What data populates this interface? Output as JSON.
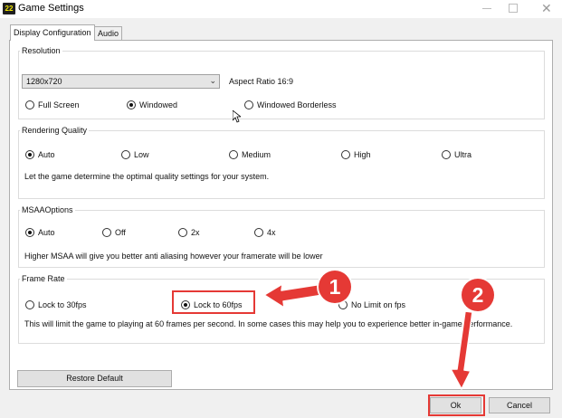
{
  "window": {
    "title": "Game Settings",
    "icon_text": "22"
  },
  "tabs": [
    {
      "label": "Display Configuration",
      "active": true
    },
    {
      "label": "Audio",
      "active": false
    }
  ],
  "resolution": {
    "label": "Resolution",
    "dropdown_value": "1280x720",
    "aspect_ratio": "Aspect Ratio 16:9",
    "modes": [
      "Full Screen",
      "Windowed",
      "Windowed Borderless"
    ],
    "selected": "Windowed"
  },
  "rendering": {
    "label": "Rendering Quality",
    "options": [
      "Auto",
      "Low",
      "Medium",
      "High",
      "Ultra"
    ],
    "selected": "Auto",
    "description": "Let the game determine the optimal quality settings for your system."
  },
  "msaa": {
    "label": "MSAAOptions",
    "options": [
      "Auto",
      "Off",
      "2x",
      "4x"
    ],
    "selected": "Auto",
    "description": "Higher MSAA will give you better anti aliasing however your framerate will be lower"
  },
  "framerate": {
    "label": "Frame Rate",
    "options": [
      "Lock  to 30fps",
      "Lock to 60fps",
      "No Limit on fps"
    ],
    "selected": "Lock to 60fps",
    "description": "This will limit the game to playing at 60 frames per second. In some cases this may help you to experience better in-game performance."
  },
  "buttons": {
    "restore": "Restore Default",
    "ok": "Ok",
    "cancel": "Cancel"
  },
  "annotations": {
    "badge1": "1",
    "badge2": "2"
  },
  "colors": {
    "annotation_red": "#e53935",
    "window_bg": "#f0f0f0",
    "panel_bg": "#ffffff"
  }
}
